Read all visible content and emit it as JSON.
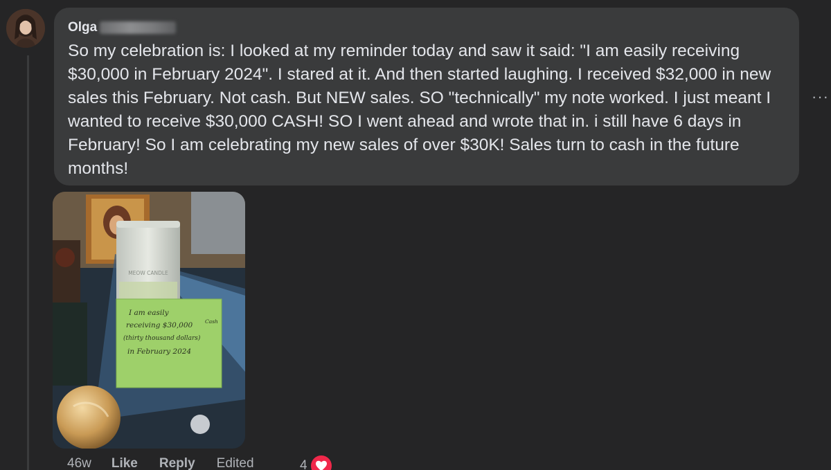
{
  "comment": {
    "author_name": "Olga",
    "text": "So my celebration is: I looked at my reminder today and saw it said: \"I am easily receiving $30,000 in February 2024\". I stared at it. And then started laughing. I received $32,000 in new sales this February. Not cash. But NEW sales. SO \"technically\" my note worked. I just meant I wanted to receive $30,000 CASH! SO I went ahead and wrote that in. i still have 6 days in February! So I am celebrating my new sales of over $30K! Sales turn to cash in the future months!"
  },
  "menu": {
    "more_label": "···"
  },
  "photo": {
    "candle_label": "MEOW CANDLE",
    "note_lines": [
      "I am easily",
      "receiving $30,000",
      "(thirty thousand dollars)",
      "in February 2024"
    ],
    "note_addition": "Cash"
  },
  "actions": {
    "timestamp": "46w",
    "like_label": "Like",
    "reply_label": "Reply",
    "edited_label": "Edited",
    "reaction_count": "4",
    "reaction_icon": "heart-icon"
  },
  "colors": {
    "background": "#252526",
    "bubble": "#3a3b3c",
    "text": "#e4e6eb",
    "secondary_text": "#b0b3b8",
    "heart": "#f0284a"
  }
}
